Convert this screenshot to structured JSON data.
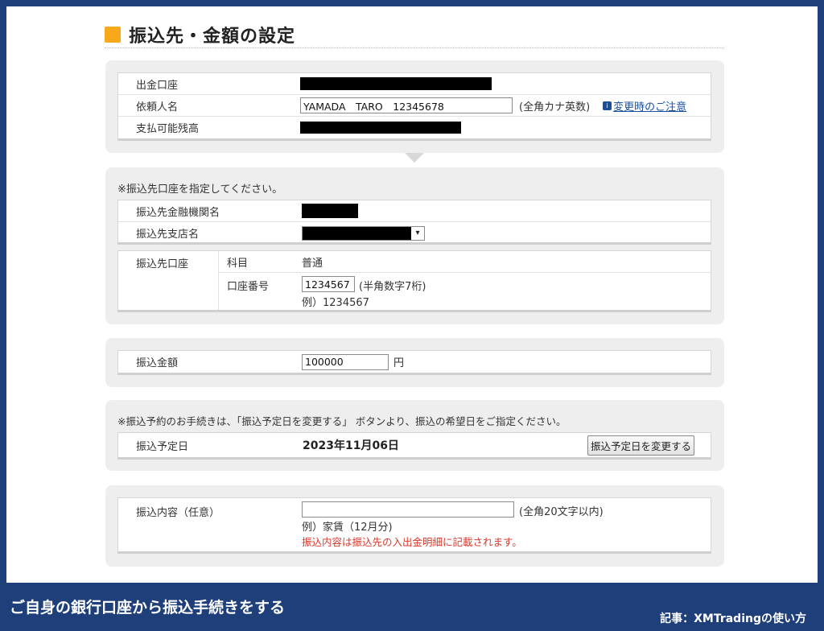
{
  "title": "振込先・金額の設定",
  "source_section": {
    "account_label": "出金口座",
    "requester_label": "依頼人名",
    "requester_value": "YAMADA　TARO　12345678",
    "requester_note": "(全角カナ英数)",
    "requester_link": "変更時のご注意",
    "balance_label": "支払可能残高"
  },
  "dest_section": {
    "intro": "※振込先口座を指定してください。",
    "bank_label": "振込先金融機関名",
    "branch_label": "振込先支店名",
    "account_label": "振込先口座",
    "type_label": "科目",
    "type_value": "普通",
    "number_label": "口座番号",
    "number_value": "1234567",
    "number_note": "(半角数字7桁)",
    "number_example": "例）1234567"
  },
  "amount_section": {
    "label": "振込金額",
    "value": "100000",
    "unit": "円"
  },
  "date_section": {
    "intro": "※振込予約のお手続きは、「振込予定日を変更する」 ボタンより、振込の希望日をご指定ください。",
    "label": "振込予定日",
    "value": "2023年11月06日",
    "button": "振込予定日を変更する"
  },
  "memo_section": {
    "label": "振込内容（任意）",
    "value": "",
    "note": "(全角20文字以内)",
    "example": "例）家賃（12月分)",
    "warning": "振込内容は振込先の入出金明細に記載されます。"
  },
  "footer": {
    "caption": "ご自身の銀行口座から振込手続きをする",
    "credit": "記事：XMTradingの使い方"
  },
  "colors": {
    "frame": "#1e3f7a",
    "accent": "#f7a81b",
    "link": "#1a4fa0",
    "warning": "#d63a2c"
  }
}
